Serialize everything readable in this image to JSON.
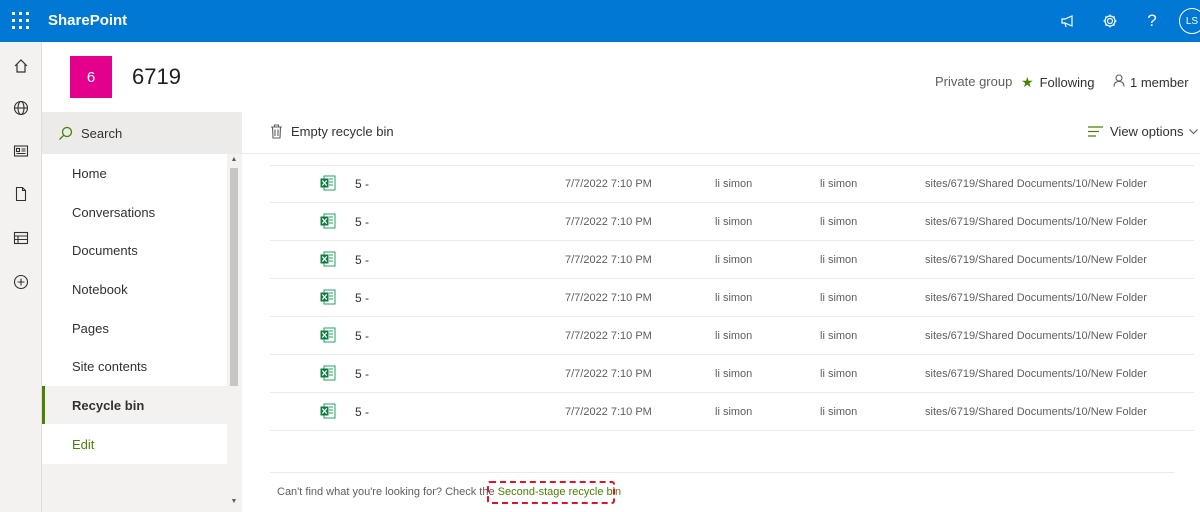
{
  "suite_bar": {
    "brand": "SharePoint",
    "avatar_initials": "LS",
    "icons": [
      "app-launcher-icon",
      "megaphone-icon",
      "gear-icon",
      "help-icon"
    ],
    "accent_color": "#0078d4"
  },
  "app_rail": {
    "icons": [
      "home-icon",
      "globe-icon",
      "news-icon",
      "document-icon",
      "list-icon",
      "add-icon"
    ]
  },
  "site": {
    "logo_letter": "6",
    "logo_color": "#e3008c",
    "title": "6719",
    "privacy": "Private group",
    "follow_label": "Following",
    "members": "1 member"
  },
  "left_nav": {
    "search_label": "Search",
    "items": [
      {
        "label": "Home"
      },
      {
        "label": "Conversations"
      },
      {
        "label": "Documents"
      },
      {
        "label": "Notebook"
      },
      {
        "label": "Pages"
      },
      {
        "label": "Site contents"
      },
      {
        "label": "Recycle bin",
        "selected": true
      },
      {
        "label": "Edit"
      }
    ]
  },
  "command_bar": {
    "empty_label": "Empty recycle bin",
    "view_options_label": "View options"
  },
  "recycle_items": [
    {
      "name": "5 -",
      "deleted": "7/7/2022 7:10 PM",
      "deleted_by": "li simon",
      "created_by": "li simon",
      "location": "sites/6719/Shared Documents/10/New Folder"
    },
    {
      "name": "5 -",
      "deleted": "7/7/2022 7:10 PM",
      "deleted_by": "li simon",
      "created_by": "li simon",
      "location": "sites/6719/Shared Documents/10/New Folder"
    },
    {
      "name": "5 -",
      "deleted": "7/7/2022 7:10 PM",
      "deleted_by": "li simon",
      "created_by": "li simon",
      "location": "sites/6719/Shared Documents/10/New Folder"
    },
    {
      "name": "5 -",
      "deleted": "7/7/2022 7:10 PM",
      "deleted_by": "li simon",
      "created_by": "li simon",
      "location": "sites/6719/Shared Documents/10/New Folder"
    },
    {
      "name": "5 -",
      "deleted": "7/7/2022 7:10 PM",
      "deleted_by": "li simon",
      "created_by": "li simon",
      "location": "sites/6719/Shared Documents/10/New Folder"
    },
    {
      "name": "5 -",
      "deleted": "7/7/2022 7:10 PM",
      "deleted_by": "li simon",
      "created_by": "li simon",
      "location": "sites/6719/Shared Documents/10/New Folder"
    },
    {
      "name": "5 -",
      "deleted": "7/7/2022 7:10 PM",
      "deleted_by": "li simon",
      "created_by": "li simon",
      "location": "sites/6719/Shared Documents/10/New Folder"
    }
  ],
  "footer": {
    "prompt": "Can't find what you're looking for? Check the ",
    "link_label": "Second-stage recycle bin"
  }
}
